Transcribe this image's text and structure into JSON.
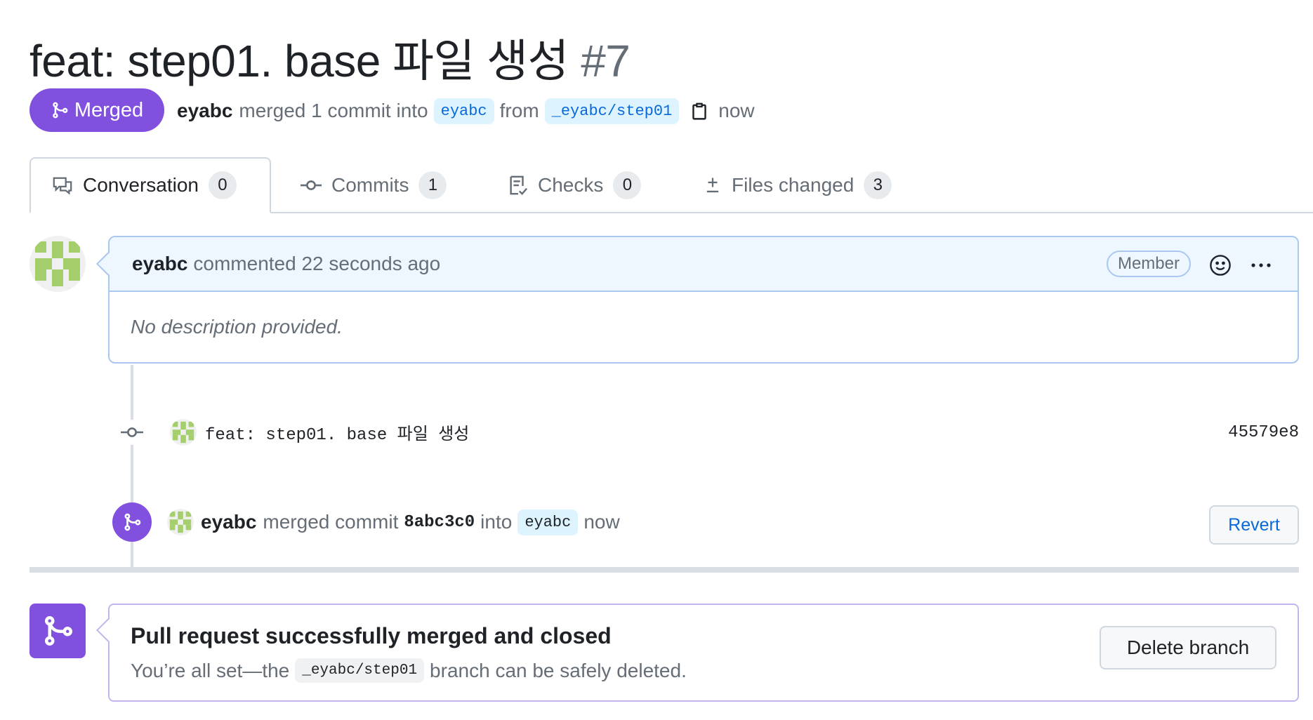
{
  "pr": {
    "title": "feat: step01. base 파일 생성",
    "number": "#7",
    "state": "Merged",
    "author": "eyabc",
    "merged_text": "merged 1 commit into",
    "base_branch": "eyabc",
    "from_text": "from",
    "head_branch": "_eyabc/step01",
    "time": "now"
  },
  "tabs": [
    {
      "label": "Conversation",
      "count": "0",
      "icon": "comment-discussion-icon"
    },
    {
      "label": "Commits",
      "count": "1",
      "icon": "git-commit-icon"
    },
    {
      "label": "Checks",
      "count": "0",
      "icon": "checklist-icon"
    },
    {
      "label": "Files changed",
      "count": "3",
      "icon": "diff-icon"
    }
  ],
  "comment": {
    "author": "eyabc",
    "action": "commented 22 seconds ago",
    "role": "Member",
    "body": "No description provided."
  },
  "commit": {
    "message": "feat: step01. base 파일 생성",
    "sha": "45579e8"
  },
  "merge_event": {
    "author": "eyabc",
    "text1": "merged commit",
    "sha": "8abc3c0",
    "text2": "into",
    "branch": "eyabc",
    "time": "now",
    "revert_label": "Revert"
  },
  "merged_box": {
    "title": "Pull request successfully merged and closed",
    "desc_before": "You’re all set—the",
    "branch": "_eyabc/step01",
    "desc_after": "branch can be safely deleted.",
    "delete_label": "Delete branch"
  },
  "colors": {
    "merged_purple": "#8250df",
    "link_blue": "#0969da",
    "avatar_green": "#a5cf6d"
  }
}
